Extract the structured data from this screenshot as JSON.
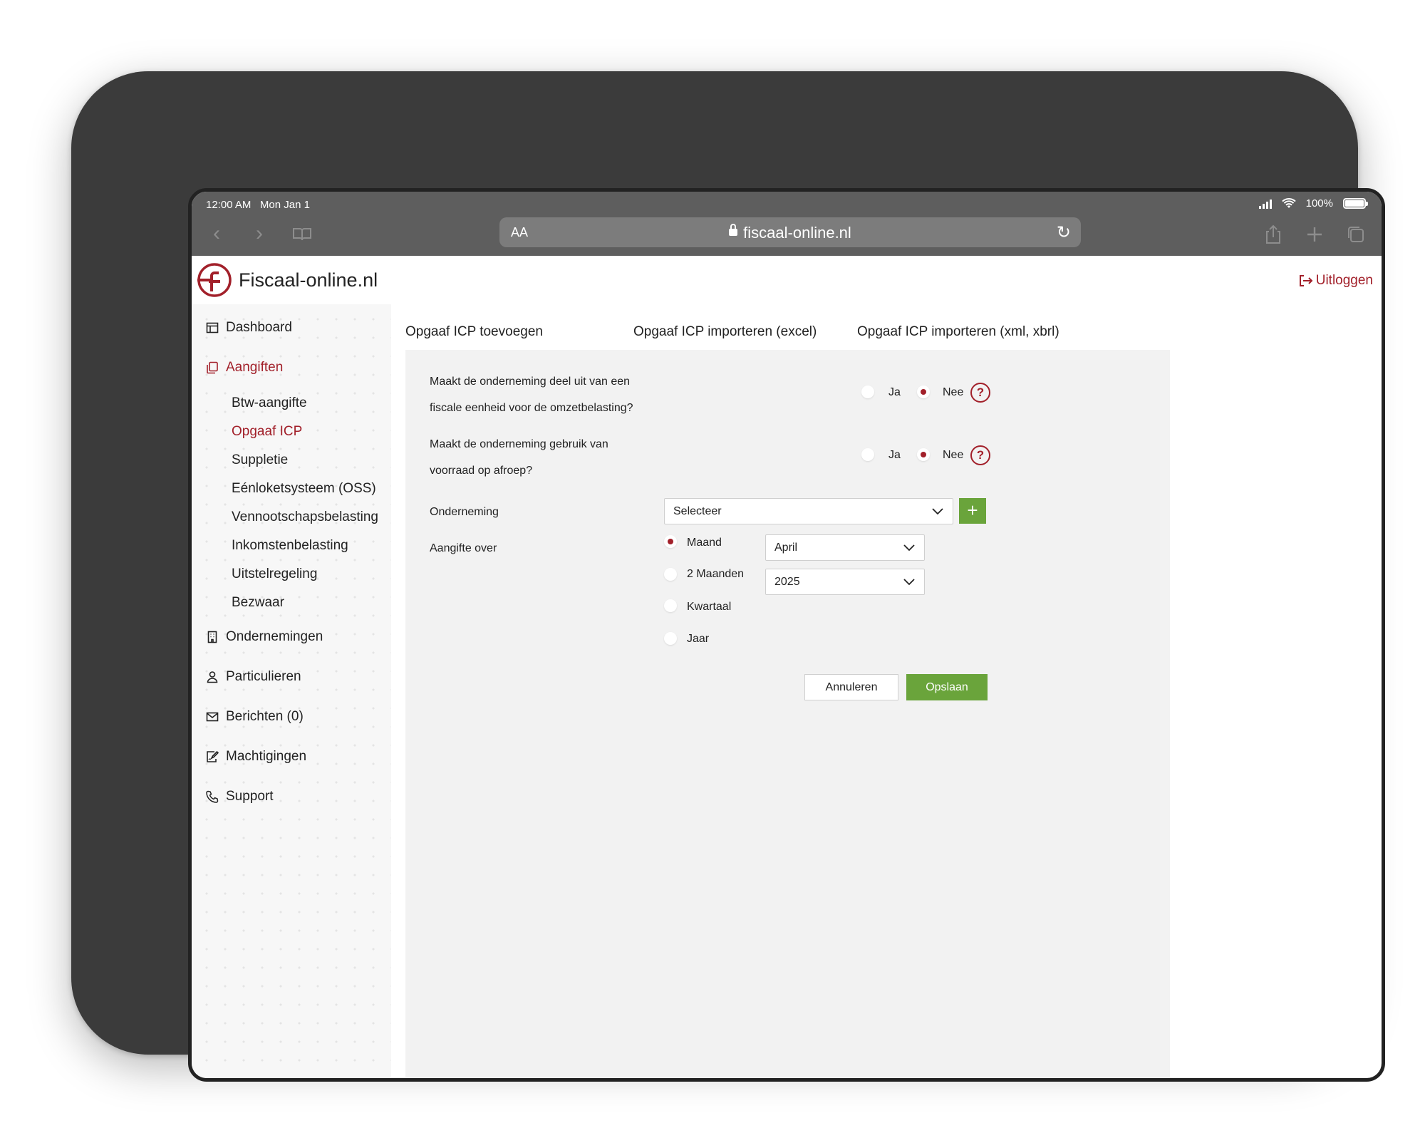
{
  "status_bar": {
    "time": "12:00 AM",
    "date": "Mon Jan 1",
    "battery": "100%"
  },
  "browser": {
    "aa_label": "AA",
    "url": "fiscaal-online.nl"
  },
  "brand": {
    "name": "Fiscaal-online.nl",
    "accent_color": "#a2202a",
    "green_color": "#6aa43b"
  },
  "header": {
    "logout_label": "Uitloggen"
  },
  "sidebar": {
    "items": [
      {
        "label": "Dashboard",
        "icon": "calendar-icon"
      },
      {
        "label": "Aangiften",
        "icon": "documents-icon",
        "active": true
      },
      {
        "label": "Ondernemingen",
        "icon": "building-icon"
      },
      {
        "label": "Particulieren",
        "icon": "user-icon"
      },
      {
        "label": "Berichten (0)",
        "icon": "envelope-icon"
      },
      {
        "label": "Machtigingen",
        "icon": "signature-icon"
      },
      {
        "label": "Support",
        "icon": "phone-icon"
      }
    ],
    "sub_items": [
      {
        "label": "Btw-aangifte"
      },
      {
        "label": "Opgaaf ICP",
        "active": true
      },
      {
        "label": "Suppletie"
      },
      {
        "label": "Eénloketsysteem (OSS)"
      },
      {
        "label": "Vennootschapsbelasting"
      },
      {
        "label": "Inkomstenbelasting"
      },
      {
        "label": "Uitstelregeling"
      },
      {
        "label": "Bezwaar"
      }
    ]
  },
  "tabs": [
    {
      "label": "Opgaaf ICP toevoegen"
    },
    {
      "label": "Opgaaf ICP importeren (excel)"
    },
    {
      "label": "Opgaaf ICP importeren (xml, xbrl)"
    }
  ],
  "form": {
    "q1": {
      "line1": "Maakt de onderneming deel uit van een",
      "line2": "fiscale eenheid voor de omzetbelasting?",
      "yes": "Ja",
      "no": "Nee",
      "selected": "Nee"
    },
    "q2": {
      "line1": "Maakt de onderneming gebruik van",
      "line2": "voorraad op afroep?",
      "yes": "Ja",
      "no": "Nee",
      "selected": "Nee"
    },
    "onderneming": {
      "label": "Onderneming",
      "value": "Selecteer",
      "add_label": "+"
    },
    "aangifte_over": {
      "label": "Aangifte over",
      "options": [
        "Maand",
        "2 Maanden",
        "Kwartaal",
        "Jaar"
      ],
      "selected": "Maand",
      "month_value": "April",
      "year_value": "2025"
    },
    "cancel_label": "Annuleren",
    "save_label": "Opslaan"
  }
}
